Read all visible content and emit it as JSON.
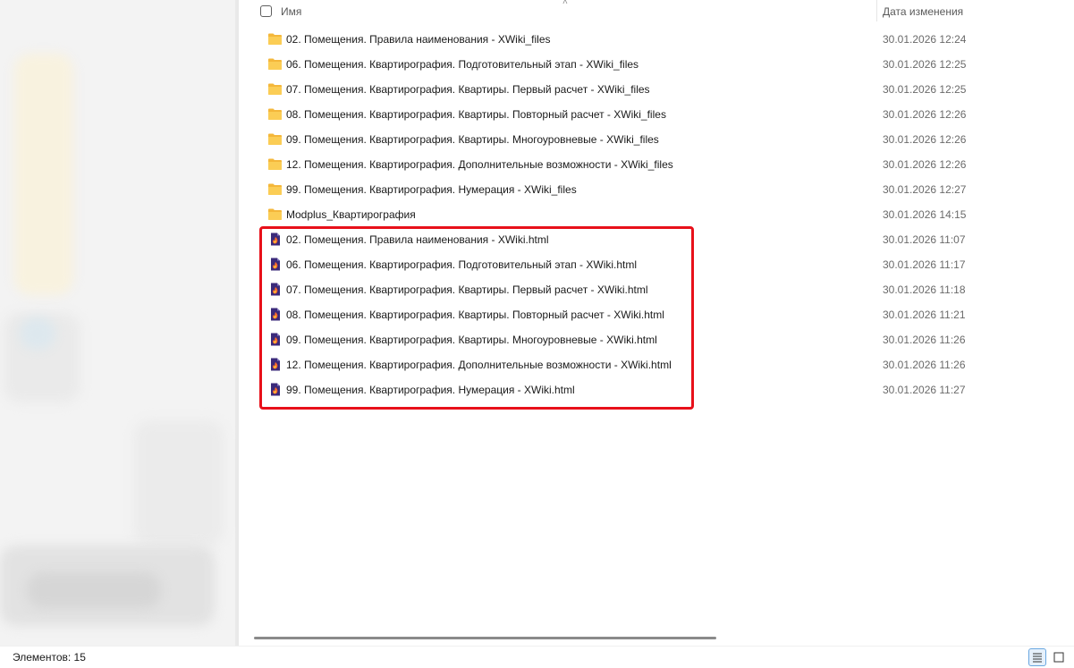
{
  "header": {
    "name_label": "Имя",
    "date_label": "Дата изменения"
  },
  "files": [
    {
      "type": "folder",
      "name": "02. Помещения. Правила наименования - XWiki_files",
      "date": "30.01.2026 12:24"
    },
    {
      "type": "folder",
      "name": "06. Помещения. Квартирография. Подготовительный этап - XWiki_files",
      "date": "30.01.2026 12:25"
    },
    {
      "type": "folder",
      "name": "07. Помещения. Квартирография. Квартиры. Первый расчет - XWiki_files",
      "date": "30.01.2026 12:25"
    },
    {
      "type": "folder",
      "name": "08. Помещения. Квартирография. Квартиры. Повторный расчет - XWiki_files",
      "date": "30.01.2026 12:26"
    },
    {
      "type": "folder",
      "name": "09. Помещения. Квартирография. Квартиры. Многоуровневые - XWiki_files",
      "date": "30.01.2026 12:26"
    },
    {
      "type": "folder",
      "name": "12. Помещения. Квартирография. Дополнительные возможности - XWiki_files",
      "date": "30.01.2026 12:26"
    },
    {
      "type": "folder",
      "name": "99. Помещения. Квартирография. Нумерация - XWiki_files",
      "date": "30.01.2026 12:27"
    },
    {
      "type": "folder",
      "name": "Modplus_Квартирография",
      "date": "30.01.2026 14:15"
    },
    {
      "type": "html",
      "name": "02. Помещения. Правила наименования - XWiki.html",
      "date": "30.01.2026 11:07"
    },
    {
      "type": "html",
      "name": "06. Помещения. Квартирография. Подготовительный этап - XWiki.html",
      "date": "30.01.2026 11:17"
    },
    {
      "type": "html",
      "name": "07. Помещения. Квартирография. Квартиры. Первый расчет - XWiki.html",
      "date": "30.01.2026 11:18"
    },
    {
      "type": "html",
      "name": "08. Помещения. Квартирография. Квартиры. Повторный расчет - XWiki.html",
      "date": "30.01.2026 11:21"
    },
    {
      "type": "html",
      "name": "09. Помещения. Квартирография. Квартиры. Многоуровневые - XWiki.html",
      "date": "30.01.2026 11:26"
    },
    {
      "type": "html",
      "name": "12. Помещения. Квартирография. Дополнительные возможности - XWiki.html",
      "date": "30.01.2026 11:26"
    },
    {
      "type": "html",
      "name": "99. Помещения. Квартирография. Нумерация - XWiki.html",
      "date": "30.01.2026 11:27"
    }
  ],
  "status_bar": {
    "item_count": "Элементов: 15"
  },
  "icons": {
    "folder": "folder-icon",
    "html": "html-file-icon",
    "details_view": "details-view-icon",
    "tiles_view": "large-icons-view-icon"
  },
  "colors": {
    "highlight": "#e8101a",
    "folder": "#f7c64a",
    "html_icon": "#3b2a7a"
  }
}
